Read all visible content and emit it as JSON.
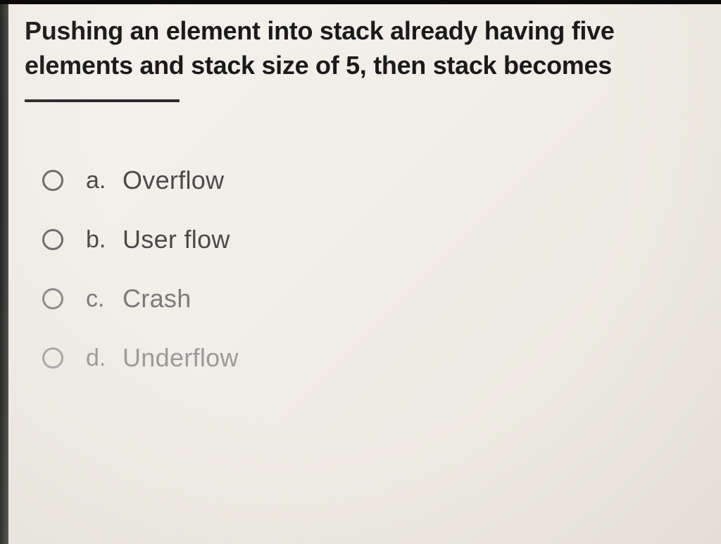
{
  "question": {
    "text": "Pushing an element into stack already having five elements and stack size of 5, then stack becomes"
  },
  "options": [
    {
      "letter": "a.",
      "text": "Overflow"
    },
    {
      "letter": "b.",
      "text": "User flow"
    },
    {
      "letter": "c.",
      "text": "Crash"
    },
    {
      "letter": "d.",
      "text": "Underflow"
    }
  ]
}
